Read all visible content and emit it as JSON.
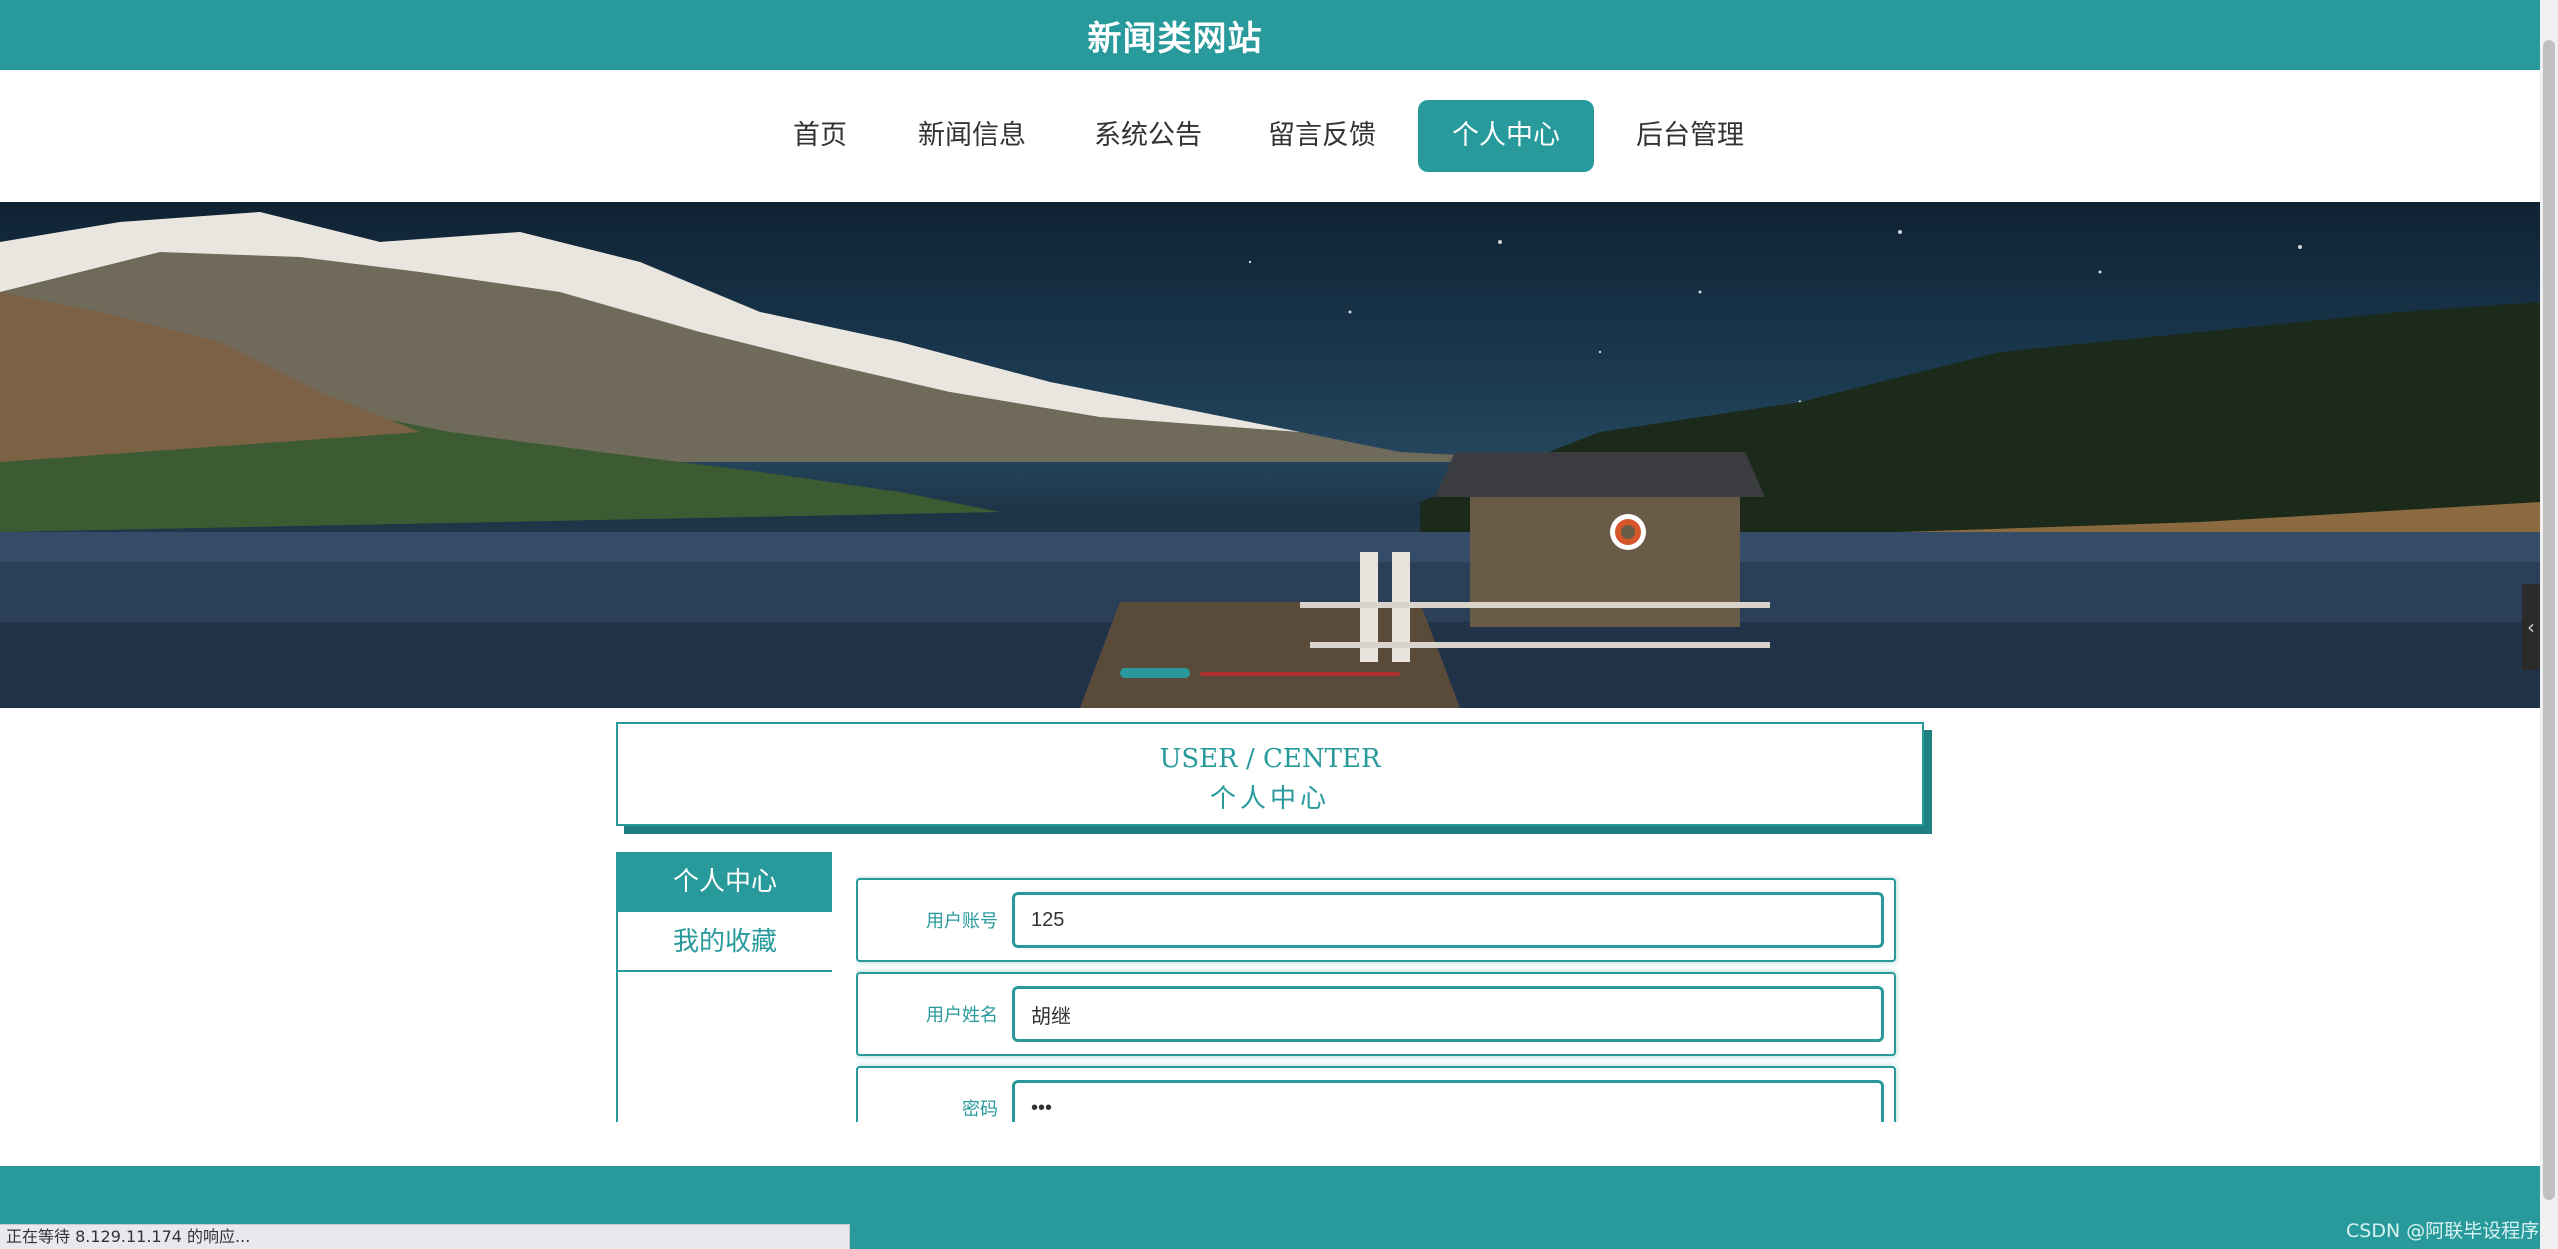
{
  "site": {
    "title": "新闻类网站"
  },
  "nav": {
    "items": [
      {
        "label": "首页",
        "active": false
      },
      {
        "label": "新闻信息",
        "active": false
      },
      {
        "label": "系统公告",
        "active": false
      },
      {
        "label": "留言反馈",
        "active": false
      },
      {
        "label": "个人中心",
        "active": true
      },
      {
        "label": "后台管理",
        "active": false
      }
    ]
  },
  "banner": {
    "image": "mountain-lake-pier-night-photo",
    "active_slide": 1
  },
  "user_center": {
    "title_en": "USER / CENTER",
    "title_zh": "个人中心"
  },
  "side_menu": {
    "items": [
      {
        "label": "个人中心",
        "active": true
      },
      {
        "label": "我的收藏",
        "active": false
      }
    ]
  },
  "form": {
    "fields": [
      {
        "label": "用户账号",
        "value": "125",
        "type": "text"
      },
      {
        "label": "用户姓名",
        "value": "胡继",
        "type": "text"
      },
      {
        "label": "密码",
        "value": "***",
        "type": "password"
      }
    ]
  },
  "status_bar": {
    "text": "正在等待 8.129.11.174 的响应..."
  },
  "watermark": {
    "text": "CSDN @阿联毕设程序"
  },
  "colors": {
    "accent": "#289a9c",
    "accent_dark": "#1f7f81",
    "text": "#333333",
    "background": "#ffffff"
  },
  "icons": {
    "side_tab": "chevron-left-icon"
  }
}
